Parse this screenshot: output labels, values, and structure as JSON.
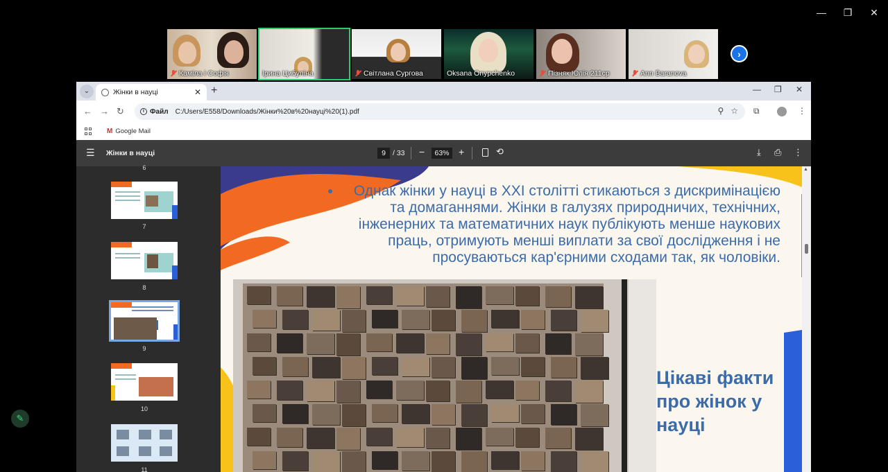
{
  "window_controls": {
    "minimize": "—",
    "restore": "❐",
    "close": "✕"
  },
  "participants": [
    {
      "name": "Каміла і Софія",
      "muted": true,
      "active": false
    },
    {
      "name": "Ірина Цибуліна",
      "muted": false,
      "active": true
    },
    {
      "name": "Світлана Сургова",
      "muted": true,
      "active": false
    },
    {
      "name": "Oksana Onypchenko",
      "muted": false,
      "active": false
    },
    {
      "name": "Пізняк Юлія 211ср",
      "muted": true,
      "active": false
    },
    {
      "name": "Ann Baranova",
      "muted": true,
      "active": false
    }
  ],
  "next_arrow": "›",
  "browser": {
    "tab_title": "Жінки в науці",
    "tab_close": "✕",
    "new_tab": "+",
    "address_chip": "Файл",
    "address": "C:/Users/E558/Downloads/Жінки%20в%20науці%20(1).pdf",
    "bookmark": "Google Mail",
    "gmail_letter": "M"
  },
  "pdf": {
    "title": "Жінки в науці",
    "current_page": "9",
    "total_pages": "/ 33",
    "zoom": "63%",
    "thumbnails": [
      {
        "num": "6"
      },
      {
        "num": "7"
      },
      {
        "num": "8"
      },
      {
        "num": "9",
        "selected": true
      },
      {
        "num": "10"
      },
      {
        "num": "11"
      }
    ]
  },
  "slide": {
    "paragraph": "Однак жінки у науці в XXI столітті стикаються з дискримінацією та домаганнями. Жінки в галузях природничих, технічних, інженерних та математичних наук публікують менше наукових праць, отримують менші виплати за свої дослідження і не просуваються кар'єрними сходами так, як чоловіки.",
    "facts_line1": "Цікаві факти",
    "facts_line2": "про жінок у",
    "facts_line3": "науці"
  },
  "colors": {
    "accent_orange": "#f26a21",
    "accent_yellow": "#f7c21a",
    "accent_blue": "#2b5fd9",
    "text_blue": "#3b6ba8",
    "active_green": "#2ecc71"
  }
}
